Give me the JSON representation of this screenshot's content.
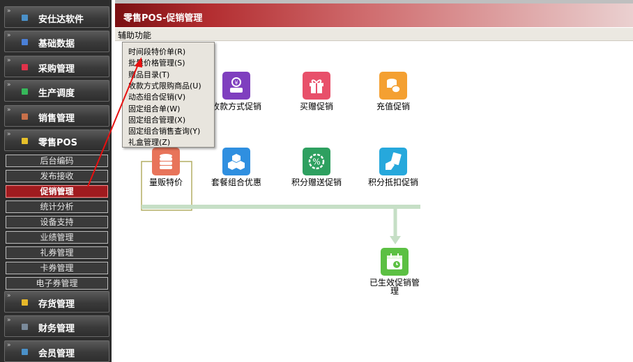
{
  "sidebar": {
    "sections_top": [
      {
        "label": "安仕达软件",
        "color": "#4a90c8"
      },
      {
        "label": "基础数据",
        "color": "#4a7fd6"
      },
      {
        "label": "采购管理",
        "color": "#e0324a"
      },
      {
        "label": "生产调度",
        "color": "#36b85a"
      },
      {
        "label": "销售管理",
        "color": "#c8704a"
      },
      {
        "label": "零售POS",
        "color": "#e6c02a"
      }
    ],
    "sub_items": [
      "后台编码",
      "发布接收",
      "促销管理",
      "统计分析",
      "设备支持",
      "业绩管理",
      "礼券管理",
      "卡券管理",
      "电子券管理"
    ],
    "active_sub": "促销管理",
    "sections_bottom": [
      {
        "label": "存货管理",
        "color": "#e6b82a"
      },
      {
        "label": "财务管理",
        "color": "#7a8a9a"
      },
      {
        "label": "会员管理",
        "color": "#4a90c8"
      }
    ]
  },
  "window": {
    "title": "零售POS-促销管理",
    "menu": "辅助功能"
  },
  "dropdown": {
    "items": [
      "时间段特价单(R)",
      "批量价格管理(S)",
      "赠品目录(T)",
      "收款方式限购商品(U)",
      "动态组合促销(V)",
      "固定组合单(W)",
      "固定组合管理(X)",
      "固定组合销售查询(Y)",
      "礼盒管理(Z)"
    ]
  },
  "tiles": [
    {
      "id": "shoukuan",
      "label": "收款方式促销",
      "color": "#7f3fbf",
      "icon": "hand-coin-icon"
    },
    {
      "id": "maizeng",
      "label": "买赠促销",
      "color": "#e8506a",
      "icon": "gift-icon"
    },
    {
      "id": "chongzhi",
      "label": "充值促销",
      "color": "#f4a032",
      "icon": "coin-stack-icon"
    },
    {
      "id": "liangfan",
      "label": "量贩特价",
      "color": "#e8745a",
      "icon": "database-icon"
    },
    {
      "id": "taocan",
      "label": "套餐组合优惠",
      "color": "#2f8fe0",
      "icon": "cubes-icon"
    },
    {
      "id": "jifenzengsong",
      "label": "积分赠送促销",
      "color": "#2ea060",
      "icon": "percent-badge-icon"
    },
    {
      "id": "jifendikou",
      "label": "积分抵扣促销",
      "color": "#26a8dc",
      "icon": "card-hand-icon"
    },
    {
      "id": "yishengxiao",
      "label": "已生效促销管理",
      "color": "#5cc043",
      "icon": "calendar-clock-icon"
    }
  ]
}
